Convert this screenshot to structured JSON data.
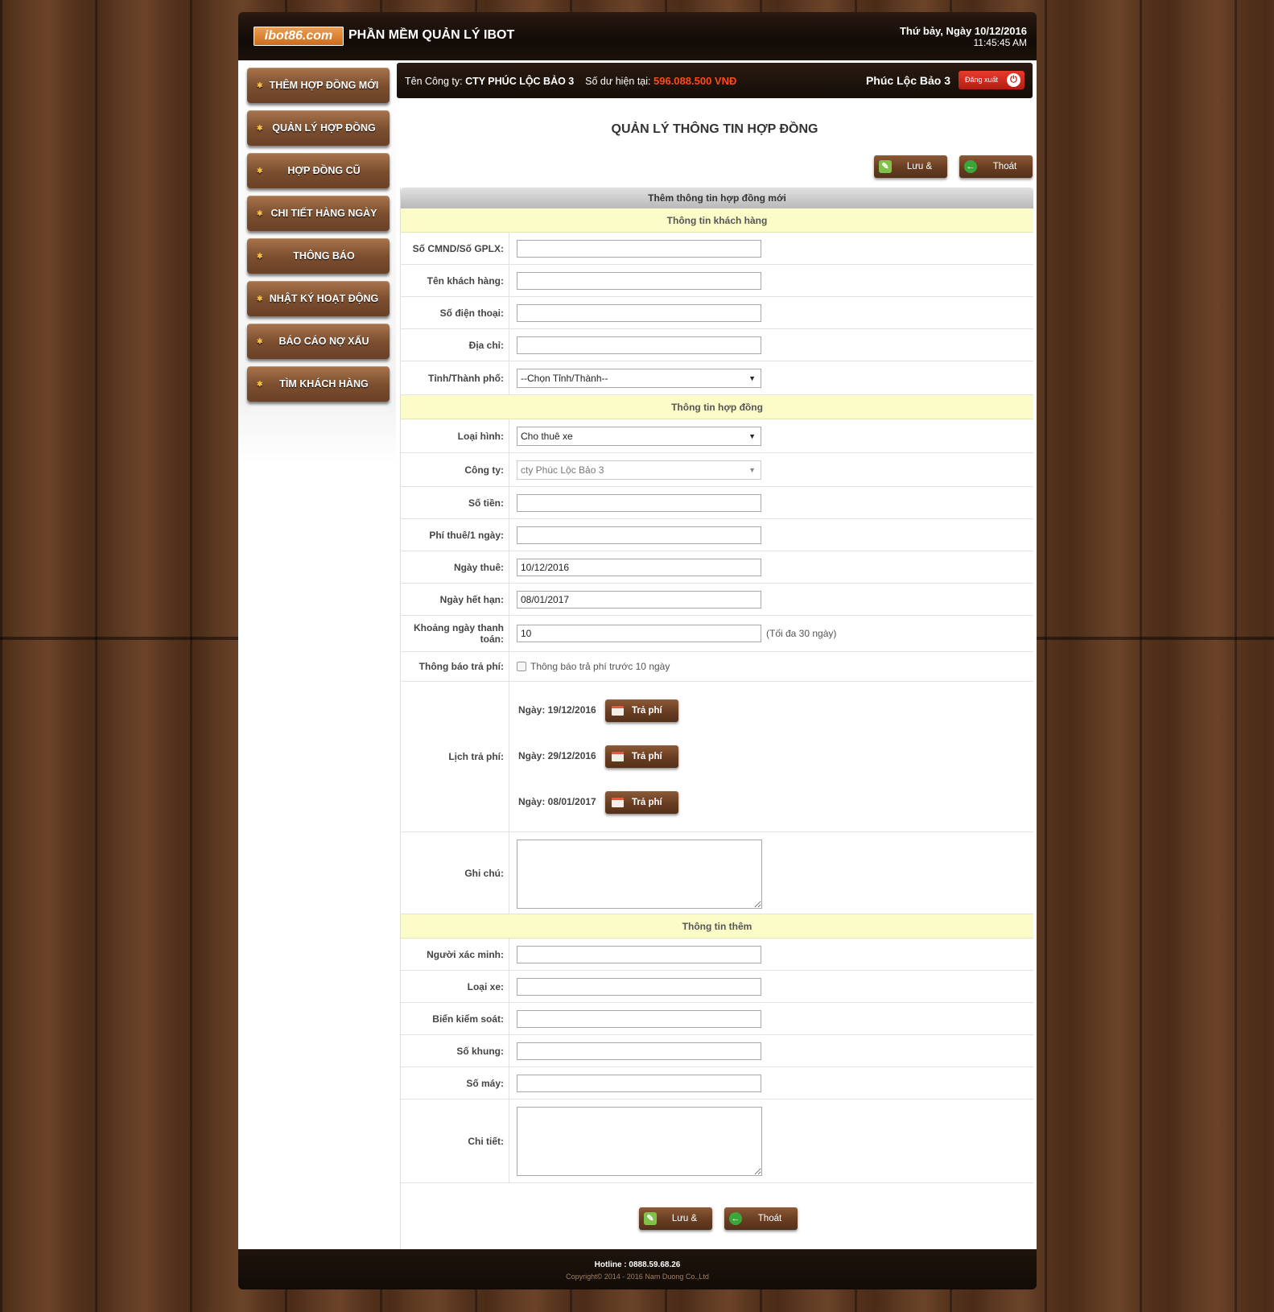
{
  "header": {
    "logo_text": "ibot86.com",
    "app_title": "PHẦN MỀM QUẢN LÝ IBOT",
    "date": "Thứ bảy, Ngày 10/12/2016",
    "time": "11:45:45 AM"
  },
  "sidebar": {
    "items": [
      {
        "label": "THÊM HỢP ĐỒNG MỚI"
      },
      {
        "label": "QUẢN LÝ HỢP ĐỒNG"
      },
      {
        "label": "HỢP ĐỒNG CŨ"
      },
      {
        "label": "CHI TIẾT HÀNG NGÀY"
      },
      {
        "label": "THÔNG BÁO"
      },
      {
        "label": "NHẬT KÝ HOẠT ĐỘNG"
      },
      {
        "label": "BÁO CÁO NỢ XẤU"
      },
      {
        "label": "TÌM KHÁCH HÀNG"
      }
    ]
  },
  "infobar": {
    "company_label": "Tên Công ty:",
    "company_name": "CTY PHÚC LỘC BẢO 3",
    "balance_label": "Số dư hiện tại:",
    "balance_value": "596.088.500 VNĐ",
    "user_name": "Phúc Lộc Bảo 3",
    "logout_label": "Đăng xuất"
  },
  "page_title": "QUẢN LÝ THÔNG TIN HỢP ĐỒNG",
  "actions": {
    "save_exit": "Lưu & Thoát",
    "exit": "Thoát"
  },
  "form": {
    "header": "Thêm thông tin hợp đồng mới",
    "section_customer": "Thông tin khách hàng",
    "section_contract": "Thông tin hợp đồng",
    "section_extra": "Thông tin thêm",
    "fields": {
      "id_card": {
        "label": "Số CMND/Số GPLX:",
        "value": ""
      },
      "customer_name": {
        "label": "Tên khách hàng:",
        "value": ""
      },
      "phone": {
        "label": "Số điện thoại:",
        "value": ""
      },
      "address": {
        "label": "Địa chỉ:",
        "value": ""
      },
      "province": {
        "label": "Tỉnh/Thành phố:",
        "value": "--Chọn Tỉnh/Thành--"
      },
      "type": {
        "label": "Loại hình:",
        "value": "Cho thuê xe"
      },
      "company": {
        "label": "Công ty:",
        "value": "cty Phúc Lộc Bảo 3"
      },
      "amount": {
        "label": "Số tiền:",
        "value": ""
      },
      "daily_fee": {
        "label": "Phí thuê/1 ngày:",
        "value": ""
      },
      "rent_date": {
        "label": "Ngày thuê:",
        "value": "10/12/2016"
      },
      "expiry_date": {
        "label": "Ngày hết hạn:",
        "value": "08/01/2017"
      },
      "pay_interval": {
        "label": "Khoảng ngày thanh toán:",
        "value": "10",
        "note": "(Tối đa 30 ngày)"
      },
      "fee_notice": {
        "label": "Thông báo trả phí:",
        "checkbox_label": "Thông báo trả phí trước 10 ngày",
        "checked": false
      },
      "schedule": {
        "label": "Lịch trả phí:",
        "button_label": "Trả phí",
        "items": [
          {
            "date": "Ngày: 19/12/2016"
          },
          {
            "date": "Ngày: 29/12/2016"
          },
          {
            "date": "Ngày: 08/01/2017"
          }
        ]
      },
      "note": {
        "label": "Ghi chú:",
        "value": ""
      },
      "verifier": {
        "label": "Người xác minh:",
        "value": ""
      },
      "vehicle_type": {
        "label": "Loại xe:",
        "value": ""
      },
      "plate": {
        "label": "Biển kiểm soát:",
        "value": ""
      },
      "frame_no": {
        "label": "Số khung:",
        "value": ""
      },
      "engine_no": {
        "label": "Số máy:",
        "value": ""
      },
      "details": {
        "label": "Chi tiết:",
        "value": ""
      }
    }
  },
  "footer": {
    "hotline": "Hotline : 0888.59.68.26",
    "copyright": "Copyright© 2014 - 2016 Nam Duong Co.,Ltd"
  }
}
